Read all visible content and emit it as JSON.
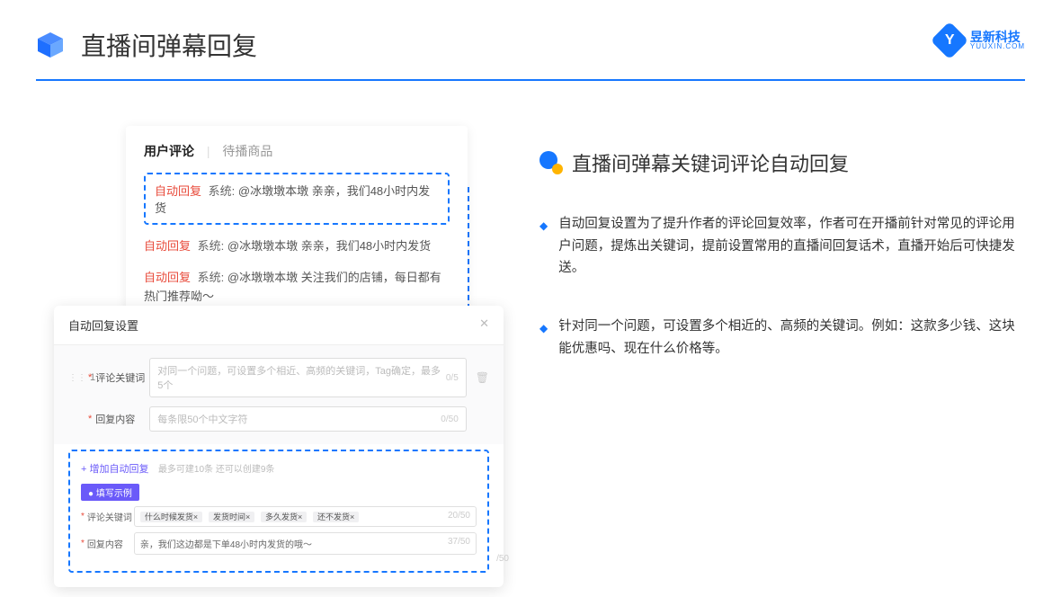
{
  "header": {
    "title": "直播间弹幕回复"
  },
  "logo": {
    "cn": "昱新科技",
    "en": "YUUXIN.COM"
  },
  "panel1": {
    "tab_active": "用户评论",
    "tab_other": "待播商品",
    "highlight": {
      "auto": "自动回复",
      "sys": "系统:",
      "text": "@冰墩墩本墩 亲亲，我们48小时内发货"
    },
    "line2": {
      "auto": "自动回复",
      "sys": "系统:",
      "text": "@冰墩墩本墩 亲亲，我们48小时内发货"
    },
    "line3": {
      "auto": "自动回复",
      "sys": "系统:",
      "text": "@冰墩墩本墩 关注我们的店铺，每日都有热门推荐呦～"
    }
  },
  "panel2": {
    "title": "自动回复设置",
    "row_index": "1",
    "label_kw": "评论关键词",
    "label_content": "回复内容",
    "placeholder_kw": "对同一个问题，可设置多个相近、高频的关键词，Tag确定，最多5个",
    "placeholder_content": "每条限50个中文字符",
    "cnt_kw": "0/5",
    "cnt_content": "0/50",
    "add_link": "+ 增加自动回复",
    "add_hint": "最多可建10条 还可以创建9条",
    "example_badge": "● 填写示例",
    "ex_kw_label": "评论关键词",
    "ex_tags": [
      "什么时候发货×",
      "发货时间×",
      "多久发货×",
      "还不发货×"
    ],
    "ex_kw_cnt": "20/50",
    "ex_content_label": "回复内容",
    "ex_content_text": "亲，我们这边都是下单48小时内发货的哦～",
    "ex_content_cnt": "37/50",
    "under_cnt": "/50"
  },
  "right": {
    "title": "直播间弹幕关键词评论自动回复",
    "p1": "自动回复设置为了提升作者的评论回复效率，作者可在开播前针对常见的评论用户问题，提炼出关键词，提前设置常用的直播间回复话术，直播开始后可快捷发送。",
    "p2": "针对同一个问题，可设置多个相近的、高频的关键词。例如：这款多少钱、这块能优惠吗、现在什么价格等。"
  }
}
